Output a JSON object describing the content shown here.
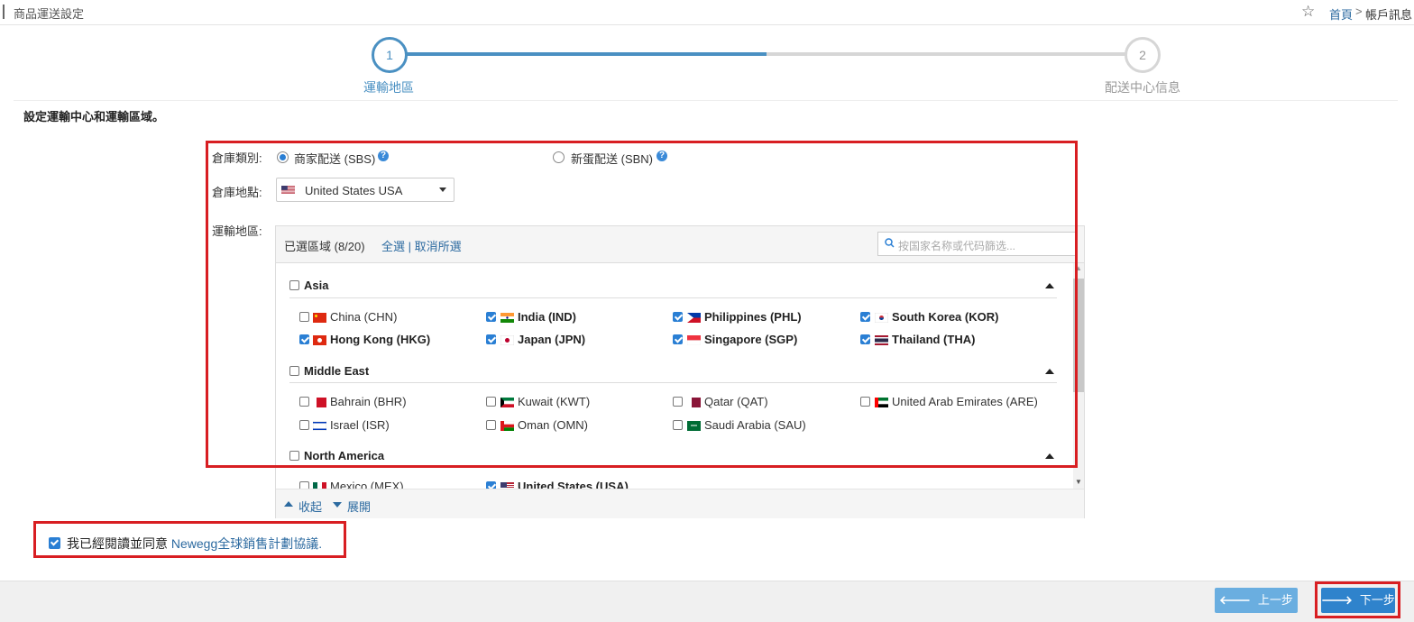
{
  "header": {
    "title": "商品運送設定",
    "breadcrumb_home": "首頁",
    "breadcrumb_sep": ">",
    "breadcrumb_current": "帳戶訊息"
  },
  "steps": [
    {
      "number": "1",
      "label": "運輸地區",
      "active": true
    },
    {
      "number": "2",
      "label": "配送中心信息",
      "active": false
    }
  ],
  "section_title": "設定運輸中心和運輸區域。",
  "form": {
    "warehouse_type_label": "倉庫類別:",
    "warehouse_type_options": [
      {
        "label": "商家配送 (SBS)",
        "selected": true
      },
      {
        "label": "新蛋配送 (SBN)",
        "selected": false
      }
    ],
    "help_icon": "?",
    "warehouse_location_label": "倉庫地點:",
    "warehouse_location_value": "United States USA",
    "shipping_region_label": "運輸地區:"
  },
  "regions_panel": {
    "selected_label": "已選區域 (8/20)",
    "select_all": "全選",
    "separator": "|",
    "deselect_all": "取消所選",
    "search_placeholder": "按国家名称或代码篩选...",
    "groups": [
      {
        "name": "Asia",
        "checked": false,
        "countries": [
          {
            "label": "China (CHN)",
            "checked": false
          },
          {
            "label": "India (IND)",
            "checked": true
          },
          {
            "label": "Philippines (PHL)",
            "checked": true
          },
          {
            "label": "South Korea (KOR)",
            "checked": true
          },
          {
            "label": "Hong Kong (HKG)",
            "checked": true
          },
          {
            "label": "Japan (JPN)",
            "checked": true
          },
          {
            "label": "Singapore (SGP)",
            "checked": true
          },
          {
            "label": "Thailand (THA)",
            "checked": true
          }
        ]
      },
      {
        "name": "Middle East",
        "checked": false,
        "countries": [
          {
            "label": "Bahrain (BHR)",
            "checked": false
          },
          {
            "label": "Kuwait (KWT)",
            "checked": false
          },
          {
            "label": "Qatar (QAT)",
            "checked": false
          },
          {
            "label": "United Arab Emirates (ARE)",
            "checked": false
          },
          {
            "label": "Israel (ISR)",
            "checked": false
          },
          {
            "label": "Oman (OMN)",
            "checked": false
          },
          {
            "label": "Saudi Arabia (SAU)",
            "checked": false
          }
        ]
      },
      {
        "name": "North America",
        "checked": false,
        "countries": [
          {
            "label": "Mexico (MEX)",
            "checked": false
          },
          {
            "label": "United States (USA)",
            "checked": true
          }
        ]
      }
    ],
    "collapse_label": "收起",
    "expand_label": "展開"
  },
  "agreement": {
    "checked": true,
    "text": "我已經閱讀並同意 ",
    "link_text": "Newegg全球銷售計劃協議."
  },
  "footer": {
    "prev_label": "上一步",
    "next_label": "下一步"
  },
  "colors": {
    "accent": "#4a90c2",
    "link": "#2c6aa0",
    "highlight_border": "#d81e22",
    "prev_button": "#6aaee0",
    "next_button": "#2f83cc"
  }
}
